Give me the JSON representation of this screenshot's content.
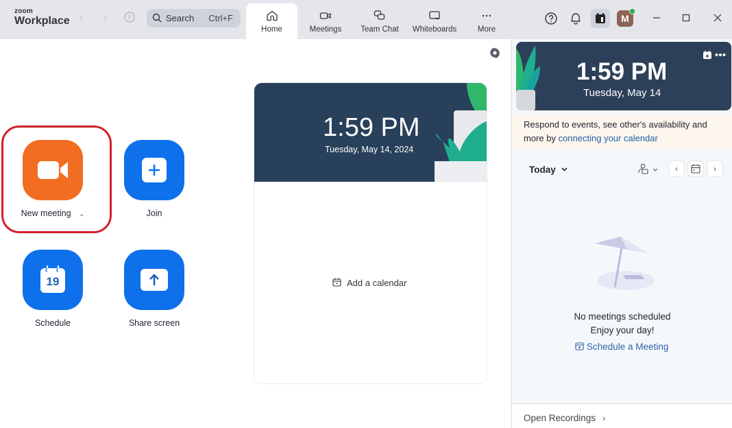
{
  "app": {
    "logo_top": "zoom",
    "logo_bottom": "Workplace"
  },
  "search": {
    "label": "Search",
    "shortcut": "Ctrl+F"
  },
  "tabs": [
    {
      "label": "Home",
      "icon": "home-icon",
      "active": true
    },
    {
      "label": "Meetings",
      "icon": "video-camera-icon",
      "active": false
    },
    {
      "label": "Team Chat",
      "icon": "chat-bubbles-icon",
      "active": false
    },
    {
      "label": "Whiteboards",
      "icon": "whiteboard-icon",
      "active": false
    },
    {
      "label": "More",
      "icon": "more-dots-icon",
      "active": false
    }
  ],
  "header_right": {
    "avatar_initial": "M",
    "presence_color": "#20b040"
  },
  "actions": [
    {
      "label": "New meeting",
      "color": "#f26d21",
      "has_dropdown": true,
      "highlighted": true
    },
    {
      "label": "Join",
      "color": "#0e71eb"
    },
    {
      "label": "Schedule",
      "color": "#0e71eb",
      "calendar_day": "19"
    },
    {
      "label": "Share screen",
      "color": "#0e71eb"
    }
  ],
  "calendar_card": {
    "time": "1:59 PM",
    "date": "Tuesday, May 14, 2024",
    "add_calendar_label": "Add a calendar"
  },
  "side_panel": {
    "time": "1:59 PM",
    "date": "Tuesday, May 14",
    "notice_text": "Respond to events, see other's availability and more by ",
    "notice_link": "connecting your calendar",
    "today_label": "Today",
    "empty_title": "No meetings scheduled",
    "empty_subtitle": "Enjoy your day!",
    "schedule_link": "Schedule a Meeting",
    "open_recordings": "Open Recordings"
  },
  "colors": {
    "accent_blue": "#0e71eb",
    "accent_orange": "#f26d21",
    "highlight_red": "#d0202a",
    "banner_navy": "#28405a"
  }
}
